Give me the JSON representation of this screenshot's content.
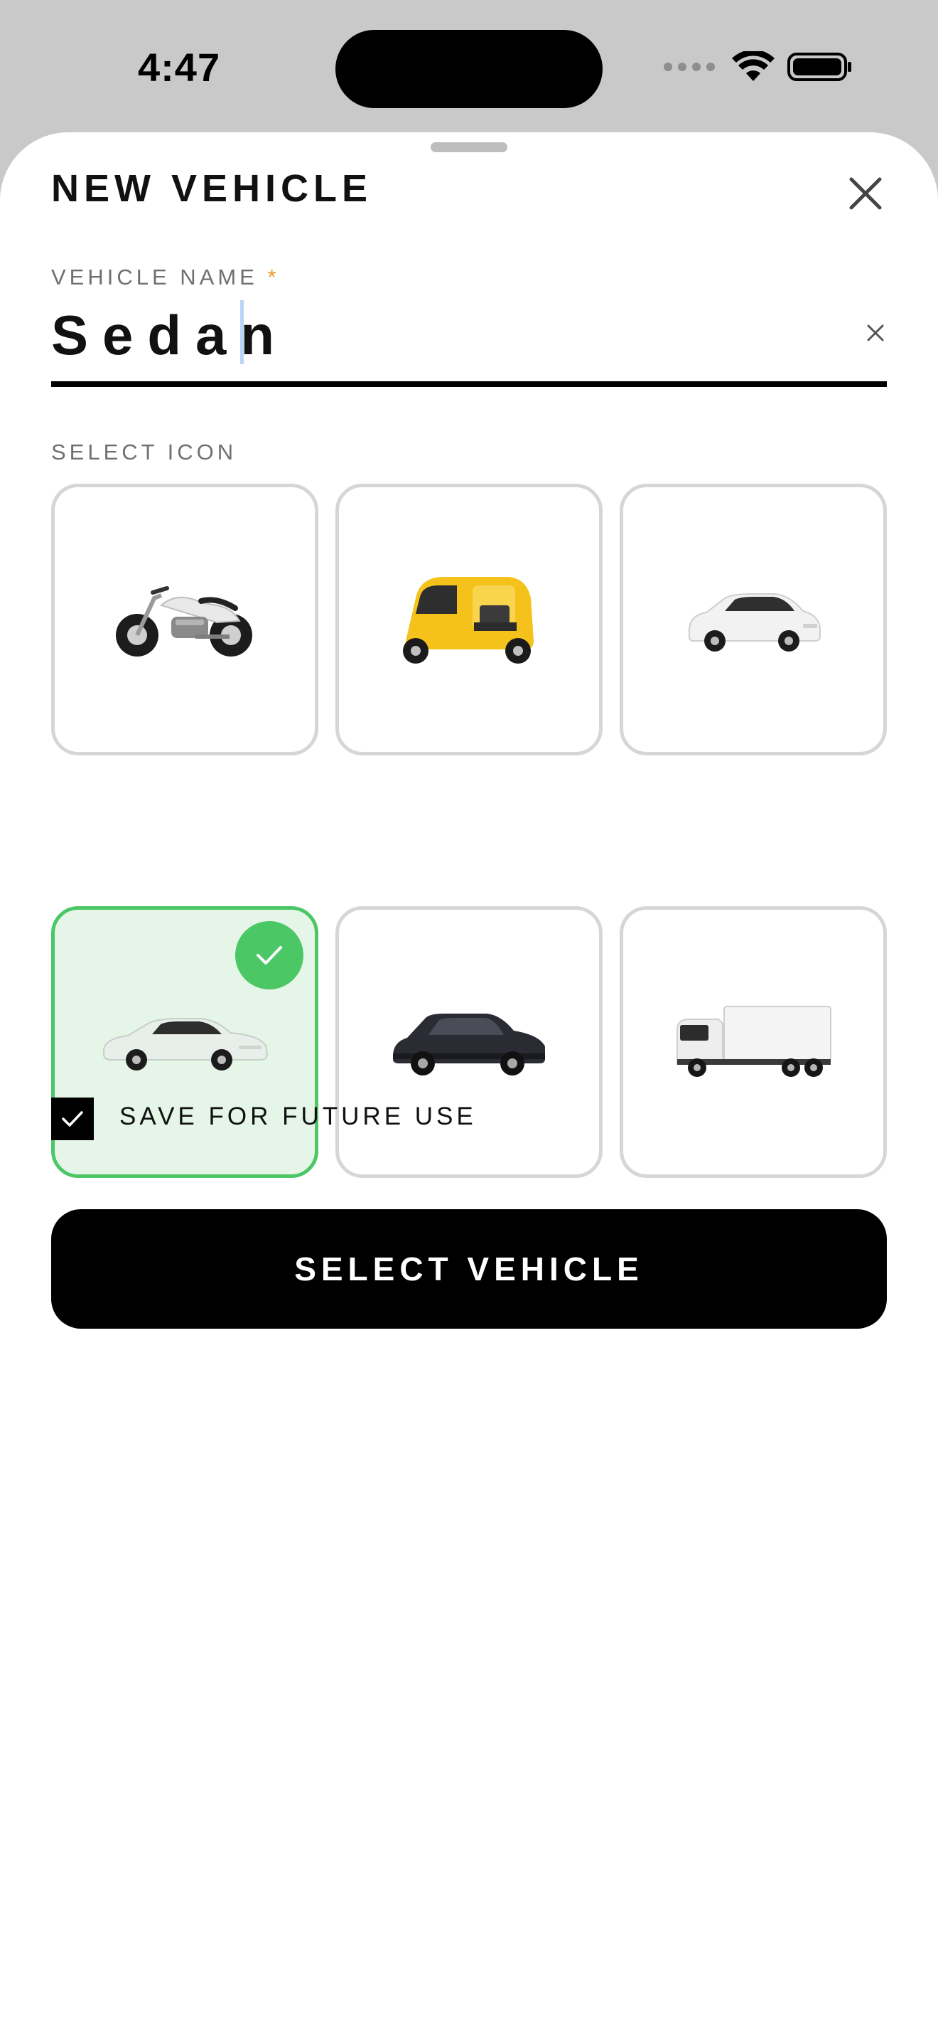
{
  "status_bar": {
    "time": "4:47"
  },
  "sheet": {
    "title": "NEW VEHICLE",
    "close_icon": "close-icon"
  },
  "vehicle_name": {
    "label": "VEHICLE NAME",
    "required_mark": "*",
    "value": "Sedan",
    "clear_icon": "clear-icon"
  },
  "icon_picker": {
    "label": "SELECT ICON",
    "selected_index": 3,
    "options": [
      {
        "icon": "motorcycle-icon",
        "selected": false
      },
      {
        "icon": "auto-rickshaw-icon",
        "selected": false
      },
      {
        "icon": "hatchback-icon",
        "selected": false
      },
      {
        "icon": "sedan-icon",
        "selected": true
      },
      {
        "icon": "suv-icon",
        "selected": false
      },
      {
        "icon": "truck-icon",
        "selected": false
      }
    ]
  },
  "save_option": {
    "label": "SAVE FOR FUTURE USE",
    "checked": true
  },
  "primary_action": {
    "label": "SELECT VEHICLE"
  },
  "colors": {
    "accent_green": "#4cc766",
    "selected_bg": "#e5f6e8",
    "required_star": "#e8a030"
  }
}
